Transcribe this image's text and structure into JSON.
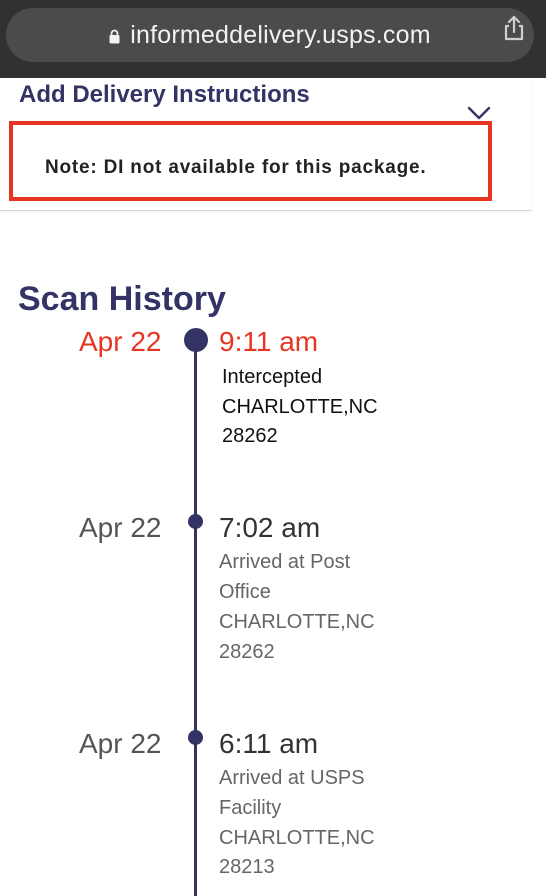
{
  "browser": {
    "url": "informeddelivery.usps.com"
  },
  "delivery_instructions": {
    "title": "Add Delivery Instructions",
    "note": "Note: DI not available for this package."
  },
  "scan_history": {
    "title": "Scan History",
    "events": [
      {
        "date": "Apr 22",
        "time": "9:11 am",
        "status": "Intercepted",
        "city": "CHARLOTTE,NC",
        "zip": "28262"
      },
      {
        "date": "Apr 22",
        "time": "7:02 am",
        "status_line1": "Arrived at Post",
        "status_line2": "Office",
        "city": "CHARLOTTE,NC",
        "zip": "28262"
      },
      {
        "date": "Apr 22",
        "time": "6:11 am",
        "status_line1": "Arrived at USPS",
        "status_line2": "Facility",
        "city": "CHARLOTTE,NC",
        "zip": "28213"
      }
    ]
  },
  "colors": {
    "browser_bar": "#313133",
    "url_pill": "#4b4b4d",
    "brand_navy": "#333366",
    "highlight_red": "#e83523",
    "muted_text": "#666666"
  },
  "icons": {
    "lock": "lock-icon",
    "share": "share-icon",
    "chevron": "chevron-down-icon",
    "timeline_dot": "timeline-dot-icon"
  }
}
